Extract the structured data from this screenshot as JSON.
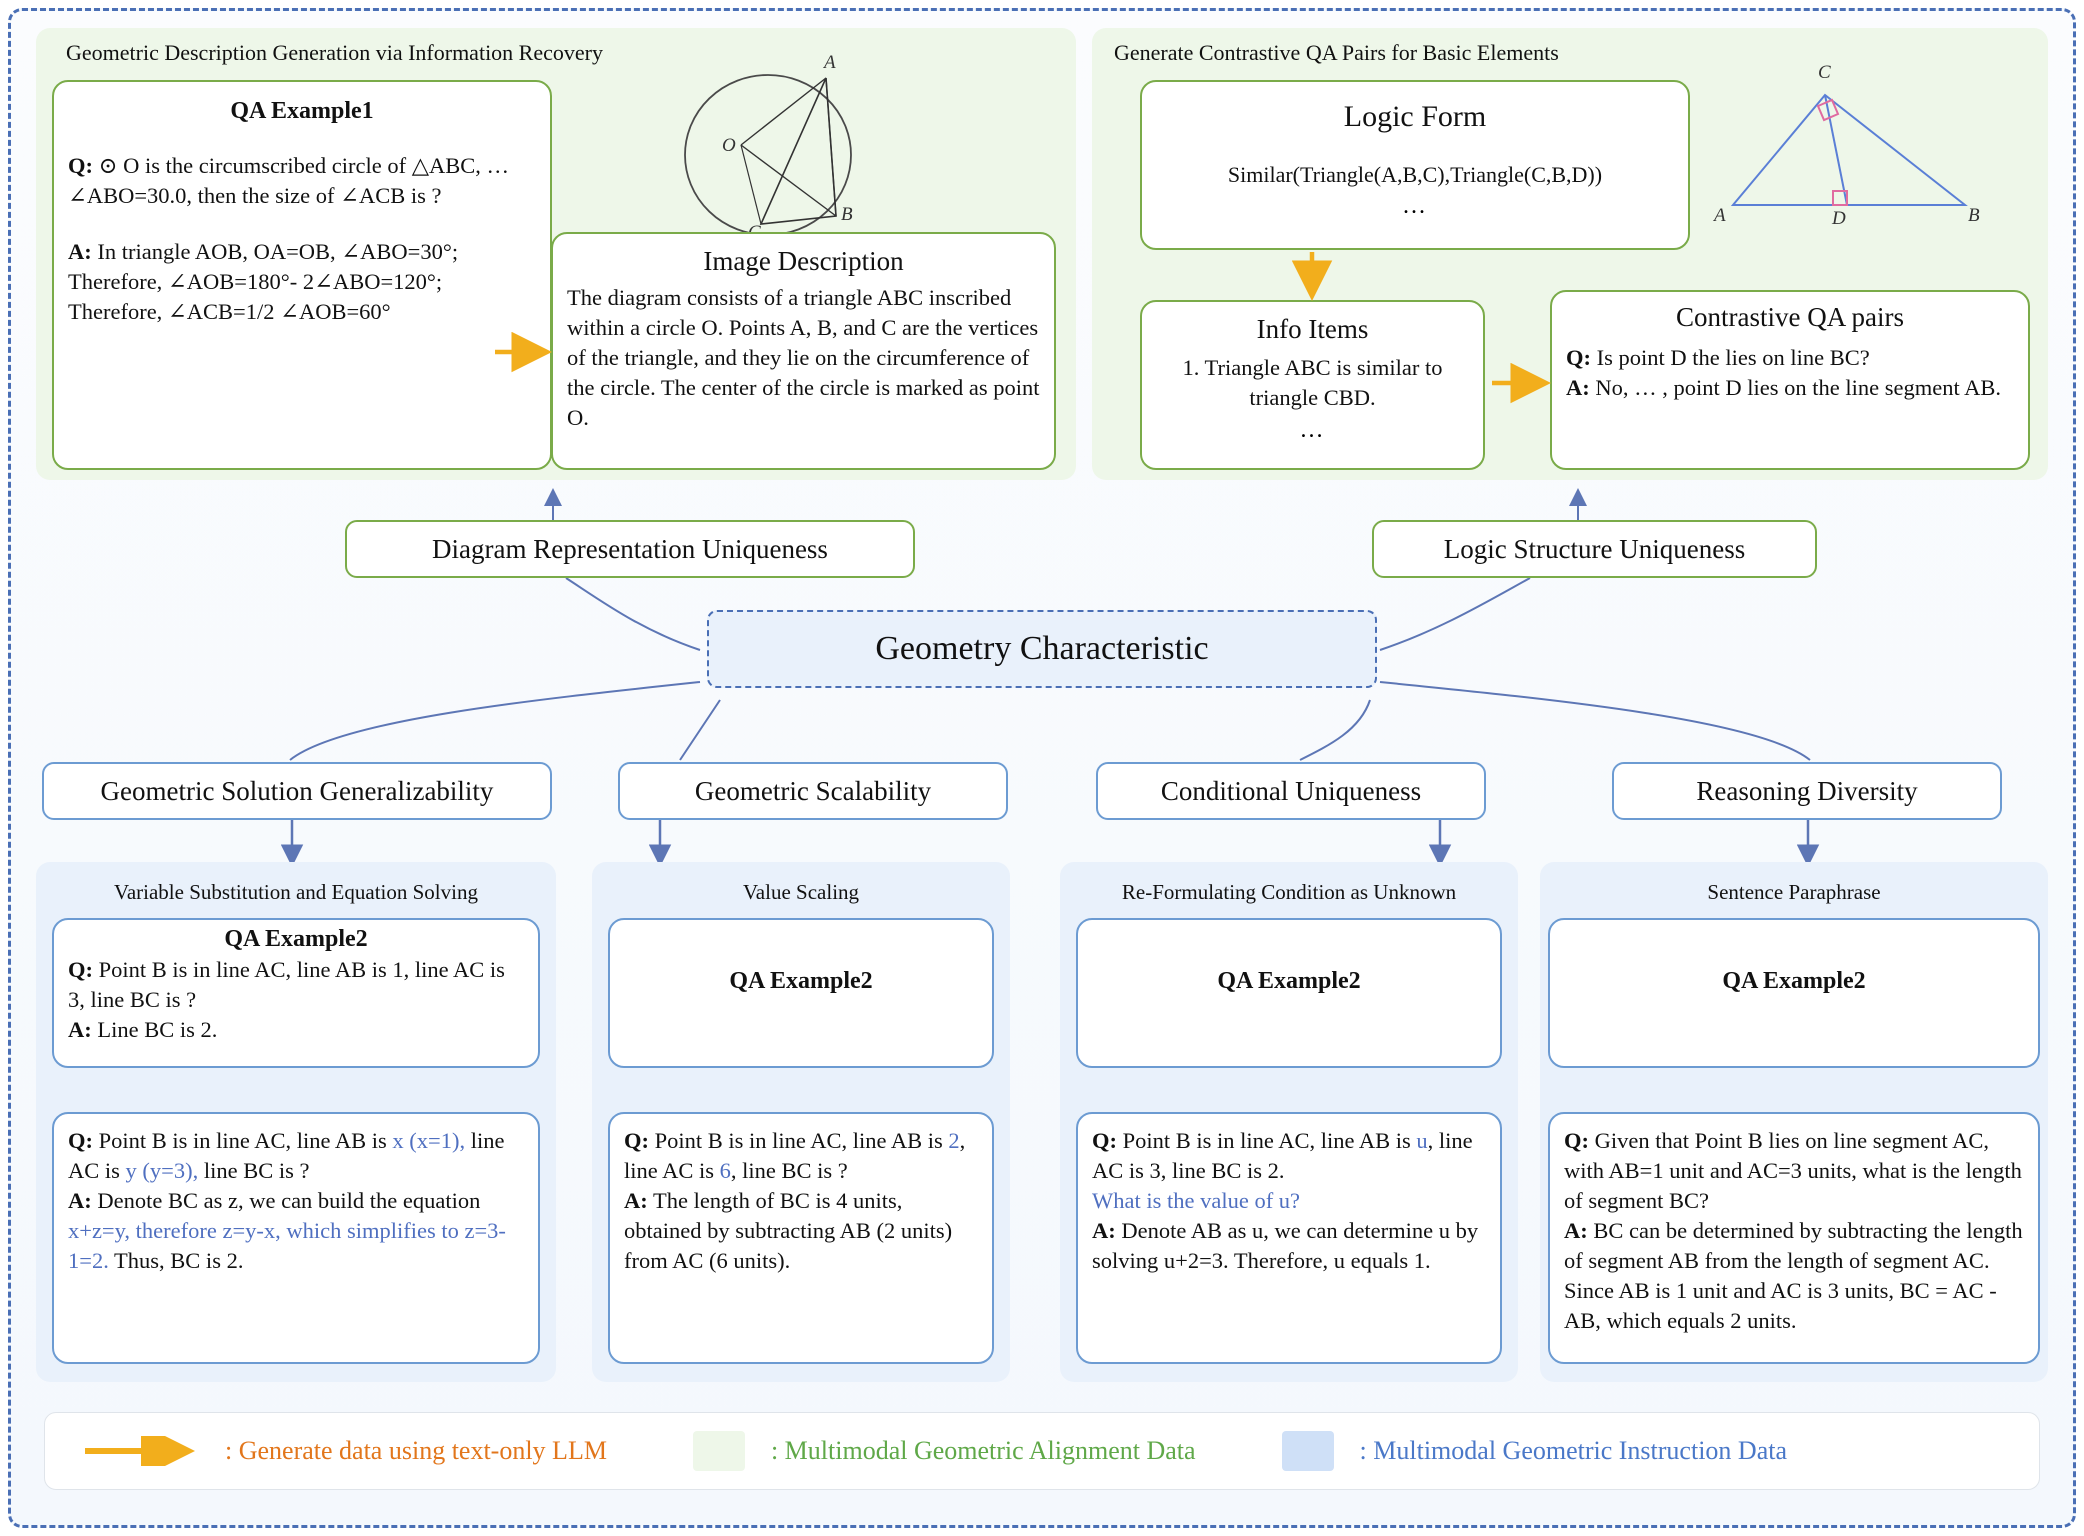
{
  "panels": {
    "left_green": {
      "title": "Geometric Description Generation via Information Recovery",
      "qa_example": {
        "heading": "QA Example1",
        "q_label": "Q:",
        "q_text": " ⊙ O is the circumscribed circle of △ABC, … ∠ABO=30.0, then the size of ∠ACB is ?",
        "a_label": "A:",
        "a_text": " In triangle AOB, OA=OB, ∠ABO=30°; Therefore, ∠AOB=180°- 2∠ABO=120°; Therefore, ∠ACB=1/2 ∠AOB=60°"
      },
      "image_description": {
        "heading": "Image Description",
        "text": "The diagram consists of  a triangle ABC inscribed within a circle O. Points A, B, and C are the vertices of the triangle, and they lie on the circumference of the circle. The center of the circle is marked as point O."
      },
      "figure_labels": {
        "a": "A",
        "b": "B",
        "c": "C",
        "o": "O"
      }
    },
    "right_green": {
      "title": "Generate Contrastive QA Pairs for Basic Elements",
      "logic_form": {
        "heading": "Logic Form",
        "text": "Similar(Triangle(A,B,C),Triangle(C,B,D))",
        "ellipsis": "..."
      },
      "info_items": {
        "heading": "Info Items",
        "text": "1. Triangle ABC is similar to triangle CBD.",
        "ellipsis": "…"
      },
      "contrastive": {
        "heading": "Contrastive  QA pairs",
        "q_label": "Q:",
        "q_text": " Is point D the lies on line BC?",
        "a_label": "A:",
        "a_text": " No, … , point D lies on the line segment AB."
      },
      "figure_labels": {
        "a": "A",
        "b": "B",
        "c": "C",
        "d": "D"
      }
    }
  },
  "center": {
    "label": "Geometry Characteristic"
  },
  "upper_nodes": [
    {
      "label": "Diagram Representation Uniqueness"
    },
    {
      "label": "Logic Structure Uniqueness"
    }
  ],
  "lower_nodes": [
    {
      "label": "Geometric Solution Generalizability"
    },
    {
      "label": "Geometric Scalability"
    },
    {
      "label": "Conditional Uniqueness"
    },
    {
      "label": "Reasoning Diversity"
    }
  ],
  "blue_columns": [
    {
      "subtitle": "Variable Substitution and Equation Solving",
      "top": {
        "heading": "QA Example2",
        "lines": [
          {
            "label": "Q:",
            "text": " Point B is in line AC, line AB is 1, line AC is 3, line BC is ?"
          },
          {
            "label": "A:",
            "text": " Line BC is 2."
          }
        ]
      },
      "bottom_segments": [
        {
          "t": "Q:",
          "s": "bold"
        },
        {
          "t": " Point B is in line AC, line AB is ",
          "s": "plain"
        },
        {
          "t": "x (x=1),",
          "s": "blue"
        },
        {
          "t": " line AC is ",
          "s": "plain"
        },
        {
          "t": "y (y=3),",
          "s": "blue"
        },
        {
          "t": " line BC is ?",
          "s": "plain"
        },
        {
          "t": "\n",
          "s": "br"
        },
        {
          "t": "A:",
          "s": "bold"
        },
        {
          "t": " Denote BC as z, we can build the equation ",
          "s": "plain"
        },
        {
          "t": "x+z=y, therefore z=y-x, which simplifies to z=3-1=2.",
          "s": "blue"
        },
        {
          "t": " Thus, BC is 2.",
          "s": "plain"
        }
      ]
    },
    {
      "subtitle": "Value Scaling",
      "top": {
        "heading": "QA Example2",
        "lines": []
      },
      "bottom_segments": [
        {
          "t": "Q:",
          "s": "bold"
        },
        {
          "t": " Point B is in line AC, line AB is ",
          "s": "plain"
        },
        {
          "t": "2",
          "s": "blue"
        },
        {
          "t": ", line AC is ",
          "s": "plain"
        },
        {
          "t": "6",
          "s": "blue"
        },
        {
          "t": ", line BC is ?",
          "s": "plain"
        },
        {
          "t": "\n",
          "s": "br"
        },
        {
          "t": "A:",
          "s": "bold"
        },
        {
          "t": " The length of BC is 4 units, obtained by subtracting AB (2 units) from AC (6 units).",
          "s": "plain"
        }
      ]
    },
    {
      "subtitle": "Re-Formulating Condition as Unknown",
      "top": {
        "heading": "QA Example2",
        "lines": []
      },
      "bottom_segments": [
        {
          "t": "Q:",
          "s": "bold"
        },
        {
          "t": " Point B is in line AC, line AB is ",
          "s": "plain"
        },
        {
          "t": "u",
          "s": "blue"
        },
        {
          "t": ", line AC is 3, line BC is 2.",
          "s": "plain"
        },
        {
          "t": "\n",
          "s": "br"
        },
        {
          "t": "What is the value of u?",
          "s": "blue"
        },
        {
          "t": "\n",
          "s": "br"
        },
        {
          "t": "A:",
          "s": "bold"
        },
        {
          "t": " Denote AB as u, we can determine u by solving u+2=3. Therefore, u equals 1.",
          "s": "plain"
        }
      ]
    },
    {
      "subtitle": "Sentence Paraphrase",
      "top": {
        "heading": "QA Example2",
        "lines": []
      },
      "bottom_segments": [
        {
          "t": "Q:",
          "s": "bold"
        },
        {
          "t": " Given that Point B lies on line segment AC, with AB=1 unit and AC=3 units, what is the length of segment BC?",
          "s": "plain"
        },
        {
          "t": "\n",
          "s": "br"
        },
        {
          "t": "A:",
          "s": "bold"
        },
        {
          "t": " BC can be determined by subtracting the length of segment AB from the length of segment AC. Since AB is 1 unit and AC is 3 units, BC = AC - AB, which equals 2 units.",
          "s": "plain"
        }
      ]
    }
  ],
  "legend": {
    "arrow_label": ": Generate data using text-only LLM",
    "green_label": ": Multimodal Geometric Alignment Data",
    "blue_label": ": Multimodal Geometric Instruction Data"
  },
  "colors": {
    "arrow": "#F2AE1C",
    "green_border": "#7aab49",
    "green_fill": "#eef7e9",
    "blue_border": "#6c9bd2",
    "blue_fill": "#e9f1fb",
    "legend_orange": "#E2761B",
    "legend_green": "#5FA848",
    "legend_blue": "#4a78c8",
    "connector": "#5d76b5",
    "text_blue": "#4f6fc0"
  }
}
